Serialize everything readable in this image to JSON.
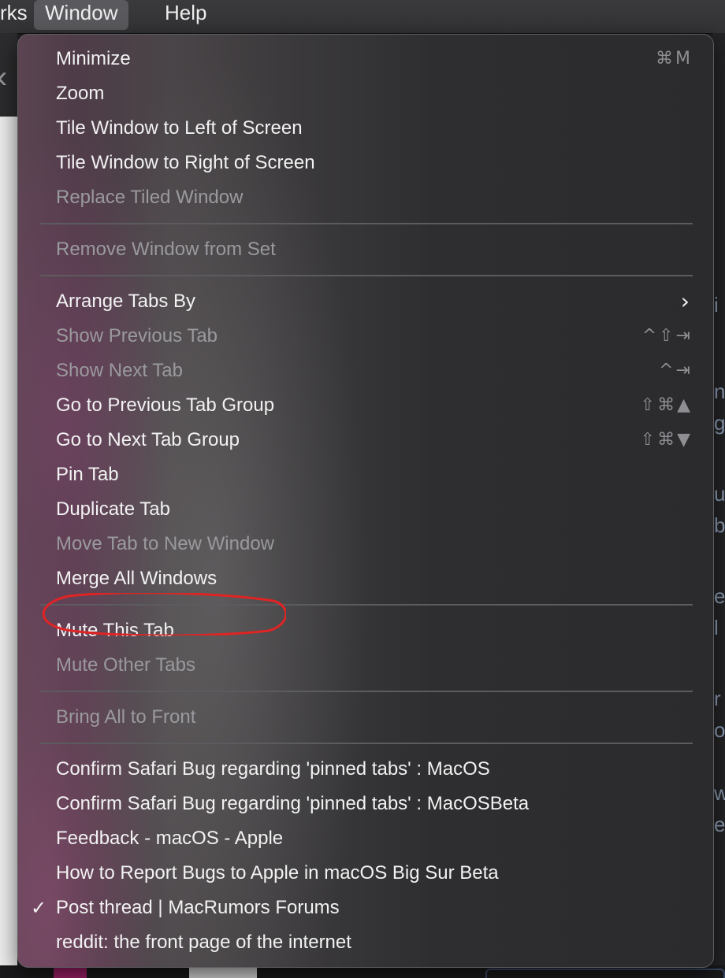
{
  "menubar": {
    "items": [
      "rks",
      "Window",
      "Help"
    ],
    "active": "Window"
  },
  "background": {
    "right_fragments": [
      "i",
      "n",
      "g",
      "u",
      "b",
      "e",
      "l",
      "r",
      "o",
      "w",
      "e"
    ]
  },
  "window_menu": {
    "groups": [
      [
        {
          "label": "Minimize",
          "shortcut": "⌘M",
          "enabled": true
        },
        {
          "label": "Zoom",
          "shortcut": "",
          "enabled": true
        },
        {
          "label": "Tile Window to Left of Screen",
          "shortcut": "",
          "enabled": true
        },
        {
          "label": "Tile Window to Right of Screen",
          "shortcut": "",
          "enabled": true
        },
        {
          "label": "Replace Tiled Window",
          "shortcut": "",
          "enabled": false
        }
      ],
      [
        {
          "label": "Remove Window from Set",
          "shortcut": "",
          "enabled": false
        }
      ],
      [
        {
          "label": "Arrange Tabs By",
          "submenu": true,
          "enabled": true
        },
        {
          "label": "Show Previous Tab",
          "shortcut": "^⇧⇥",
          "enabled": false
        },
        {
          "label": "Show Next Tab",
          "shortcut": "^⇥",
          "enabled": false
        },
        {
          "label": "Go to Previous Tab Group",
          "shortcut": "⇧⌘▲",
          "enabled": true
        },
        {
          "label": "Go to Next Tab Group",
          "shortcut": "⇧⌘▼",
          "enabled": true
        },
        {
          "label": "Pin Tab",
          "shortcut": "",
          "enabled": true
        },
        {
          "label": "Duplicate Tab",
          "shortcut": "",
          "enabled": true
        },
        {
          "label": "Move Tab to New Window",
          "shortcut": "",
          "enabled": false
        },
        {
          "label": "Merge All Windows",
          "shortcut": "",
          "enabled": true,
          "highlighted": true
        }
      ],
      [
        {
          "label": "Mute This Tab",
          "shortcut": "",
          "enabled": true
        },
        {
          "label": "Mute Other Tabs",
          "shortcut": "",
          "enabled": false
        }
      ],
      [
        {
          "label": "Bring All to Front",
          "shortcut": "",
          "enabled": false
        }
      ],
      [
        {
          "label": "Confirm Safari Bug regarding 'pinned tabs' : MacOS",
          "enabled": true
        },
        {
          "label": "Confirm Safari Bug regarding 'pinned tabs' : MacOSBeta",
          "enabled": true
        },
        {
          "label": "Feedback - macOS - Apple",
          "enabled": true
        },
        {
          "label": "How to Report Bugs to Apple in macOS Big Sur Beta",
          "enabled": true
        },
        {
          "label": "Post thread | MacRumors Forums",
          "enabled": true,
          "checked": true
        },
        {
          "label": "reddit: the front page of the internet",
          "enabled": true
        }
      ]
    ]
  },
  "annotation_color": "#e02424",
  "check_glyph": "✓",
  "submenu_glyph": "〉"
}
